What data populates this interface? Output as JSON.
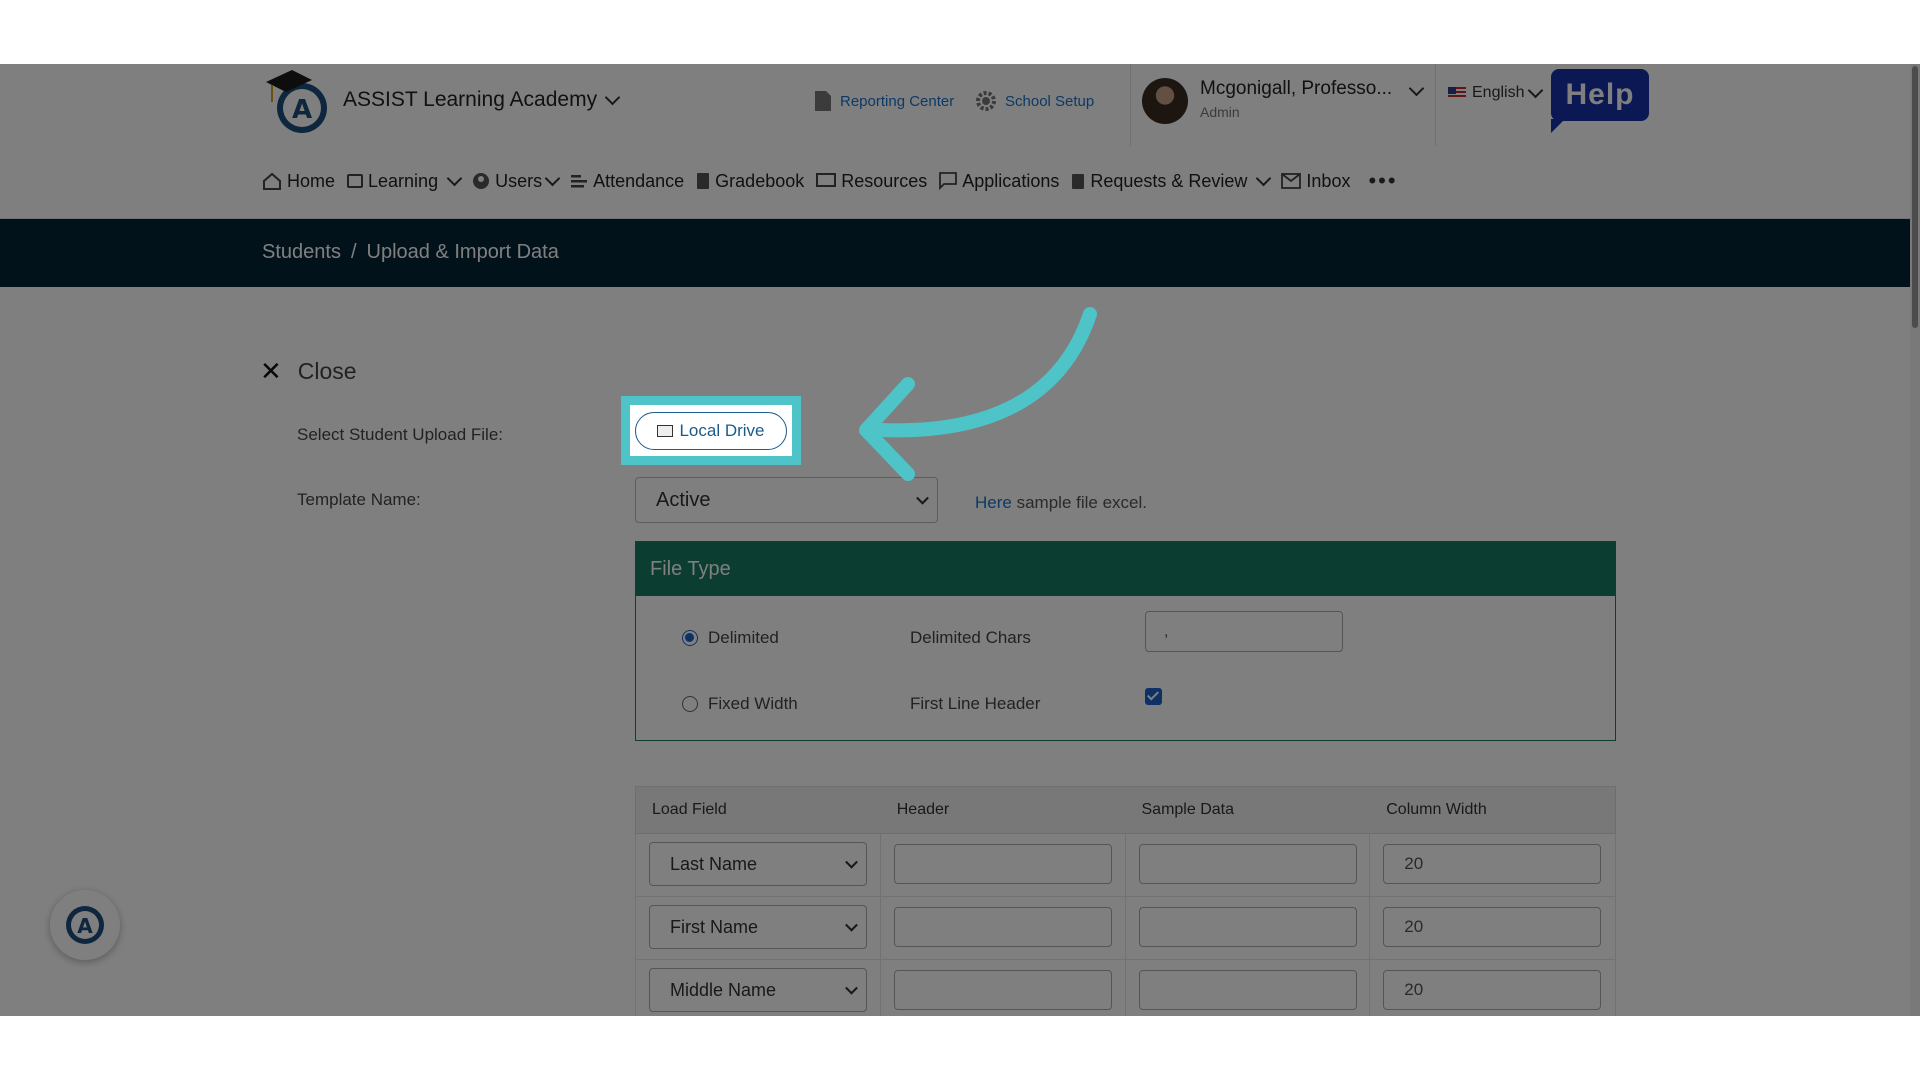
{
  "header": {
    "school_name": "ASSIST Learning Academy",
    "reporting_center": "Reporting Center",
    "school_setup": "School Setup",
    "user_name": "Mcgonigall, Professo...",
    "user_role": "Admin",
    "language": "English",
    "help": "Help"
  },
  "nav": {
    "items": [
      "Home",
      "Learning",
      "Users",
      "Attendance",
      "Gradebook",
      "Resources",
      "Applications",
      "Requests & Review",
      "Inbox"
    ],
    "more": "•••"
  },
  "breadcrumb": {
    "root": "Students",
    "sep": "/",
    "current": "Upload & Import Data"
  },
  "form": {
    "close_label": "Close",
    "upload_label": "Select Student Upload File:",
    "local_drive": "Local Drive",
    "template_label": "Template Name:",
    "template_value": "Active",
    "sample_link": "Here",
    "sample_text": "sample file excel."
  },
  "file_type": {
    "title": "File Type",
    "delimited": "Delimited",
    "fixed_width": "Fixed Width",
    "delimited_chars_label": "Delimited Chars",
    "delimited_chars_value": ",",
    "first_line_header_label": "First Line Header",
    "first_line_header_checked": true,
    "selected": "delimited"
  },
  "table": {
    "headers": [
      "Load Field",
      "Header",
      "Sample Data",
      "Column Width"
    ],
    "rows": [
      {
        "load_field": "Last Name",
        "header": "",
        "sample": "",
        "width": "20"
      },
      {
        "load_field": "First Name",
        "header": "",
        "sample": "",
        "width": "20"
      },
      {
        "load_field": "Middle Name",
        "header": "",
        "sample": "",
        "width": "20"
      }
    ]
  },
  "colors": {
    "accent": "#177a60",
    "link": "#1a73c9",
    "dark_bar": "#052437",
    "highlight": "#4ec3c8",
    "help_bg": "#1630a8"
  }
}
